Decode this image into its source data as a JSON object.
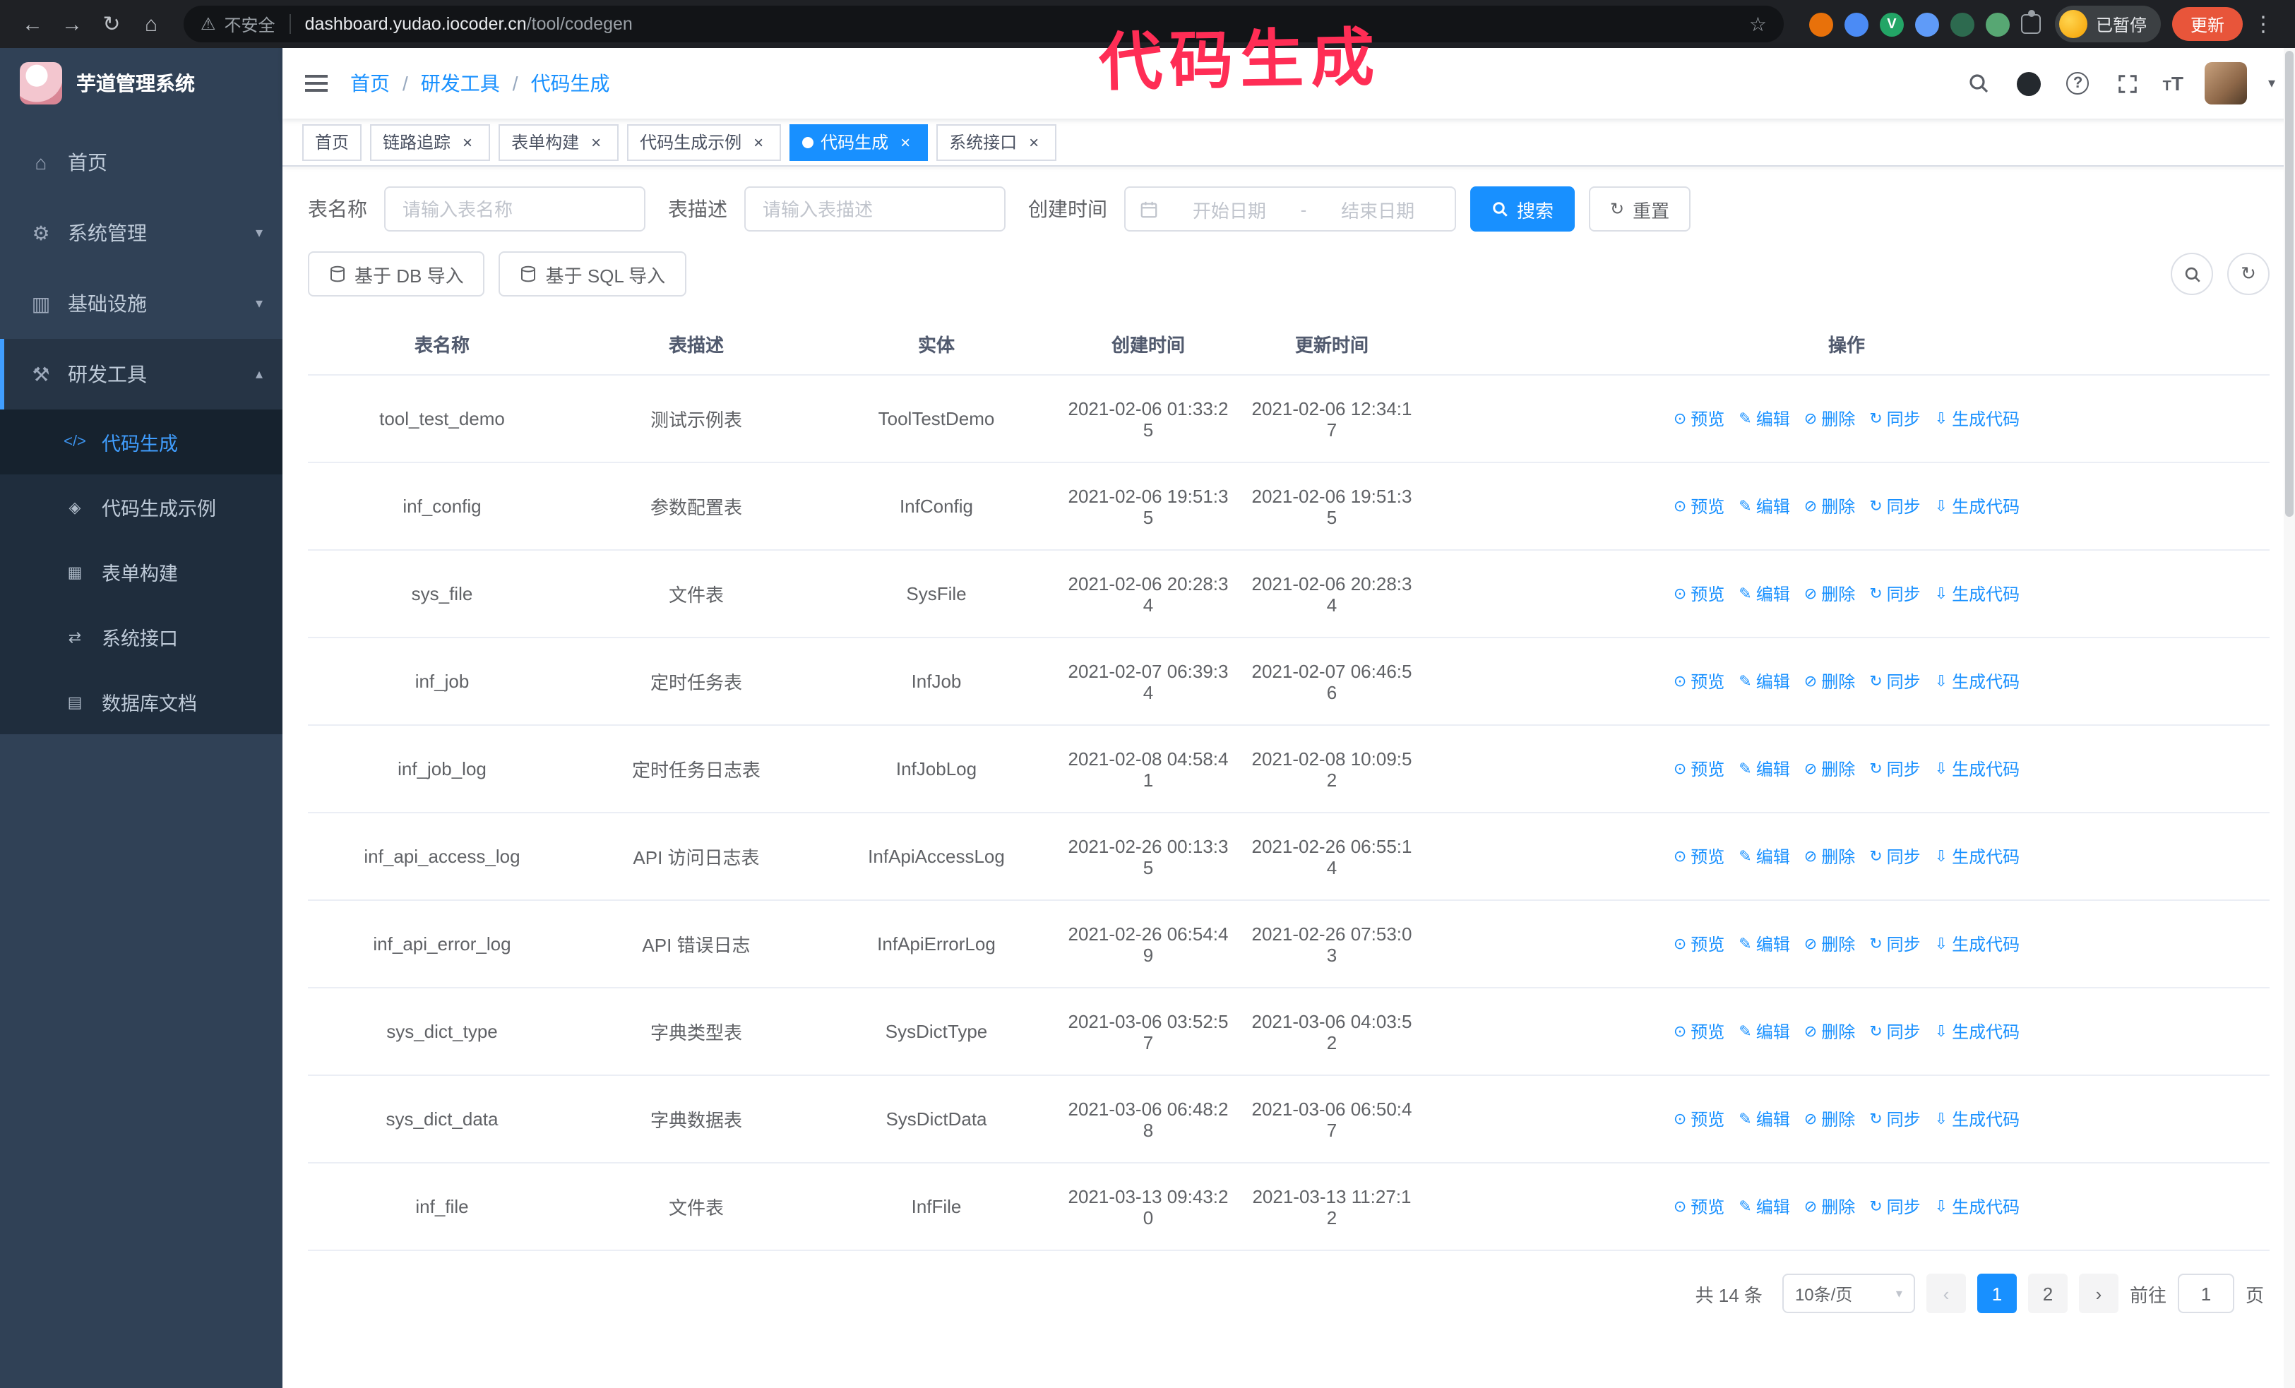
{
  "colors": {
    "accent": "#1890ff",
    "menu-active": "#409eff",
    "annotation": "#ff2d55",
    "update-btn": "#e8553a",
    "sidebar-bg": "#304156",
    "submenu-bg": "#1f2d3d"
  },
  "icons": {
    "back": "←",
    "forward": "→",
    "reload": "↻",
    "home": "⌂",
    "warning": "⚠",
    "star": "☆",
    "kebab": "⋮",
    "chevron_up": "▴",
    "chevron_down": "▾",
    "close": "×",
    "refresh": "↻",
    "prev": "‹",
    "next": "›"
  },
  "annotation": "代码生成",
  "browser": {
    "security_label": "不安全",
    "url_host": "dashboard.yudao.iocoder.cn",
    "url_path": "/tool/codegen",
    "profile_badge": "已暂停",
    "update_button": "更新"
  },
  "app_title": "芋道管理系统",
  "sidebar": {
    "items": [
      {
        "key": "home",
        "label": "首页",
        "icon": "⌂",
        "expandable": false,
        "expanded": false,
        "active": false
      },
      {
        "key": "system",
        "label": "系统管理",
        "icon": "⚙",
        "expandable": true,
        "expanded": false,
        "active": false
      },
      {
        "key": "infra",
        "label": "基础设施",
        "icon": "▥",
        "expandable": true,
        "expanded": false,
        "active": false
      },
      {
        "key": "devtools",
        "label": "研发工具",
        "icon": "⚒",
        "expandable": true,
        "expanded": true,
        "active": true
      }
    ],
    "sub_items": [
      {
        "key": "codegen",
        "label": "代码生成",
        "icon": "</>",
        "active": true
      },
      {
        "key": "codegen-example",
        "label": "代码生成示例",
        "icon": "◈",
        "active": false
      },
      {
        "key": "form-builder",
        "label": "表单构建",
        "icon": "▦",
        "active": false
      },
      {
        "key": "system-api",
        "label": "系统接口",
        "icon": "⇄",
        "active": false
      },
      {
        "key": "db-doc",
        "label": "数据库文档",
        "icon": "▤",
        "active": false
      }
    ]
  },
  "breadcrumb": [
    "首页",
    "研发工具",
    "代码生成"
  ],
  "tabs": [
    {
      "key": "home",
      "label": "首页",
      "closable": false,
      "active": false
    },
    {
      "key": "tracing",
      "label": "链路追踪",
      "closable": true,
      "active": false
    },
    {
      "key": "form-builder",
      "label": "表单构建",
      "closable": true,
      "active": false
    },
    {
      "key": "codegen-example",
      "label": "代码生成示例",
      "closable": true,
      "active": false
    },
    {
      "key": "codegen",
      "label": "代码生成",
      "closable": true,
      "active": true
    },
    {
      "key": "system-api",
      "label": "系统接口",
      "closable": true,
      "active": false
    }
  ],
  "filters": {
    "table_name_label": "表名称",
    "table_name_placeholder": "请输入表名称",
    "table_desc_label": "表描述",
    "table_desc_placeholder": "请输入表描述",
    "create_time_label": "创建时间",
    "start_date_placeholder": "开始日期",
    "date_separator": "-",
    "end_date_placeholder": "结束日期",
    "search_button": "搜索",
    "reset_button": "重置"
  },
  "toolbar": {
    "import_db_button": "基于 DB 导入",
    "import_sql_button": "基于 SQL 导入"
  },
  "table": {
    "columns": [
      "表名称",
      "表描述",
      "实体",
      "创建时间",
      "更新时间",
      "操作"
    ],
    "actions": [
      {
        "key": "preview",
        "label": "预览",
        "glyph": "⊙"
      },
      {
        "key": "edit",
        "label": "编辑",
        "glyph": "✎"
      },
      {
        "key": "delete",
        "label": "删除",
        "glyph": "⊘"
      },
      {
        "key": "sync",
        "label": "同步",
        "glyph": "↻"
      },
      {
        "key": "generate-code",
        "label": "生成代码",
        "glyph": "⇩"
      }
    ],
    "rows": [
      {
        "name": "tool_test_demo",
        "desc": "测试示例表",
        "entity": "ToolTestDemo",
        "created": "2021-02-06 01:33:25",
        "updated": "2021-02-06 12:34:17"
      },
      {
        "name": "inf_config",
        "desc": "参数配置表",
        "entity": "InfConfig",
        "created": "2021-02-06 19:51:35",
        "updated": "2021-02-06 19:51:35"
      },
      {
        "name": "sys_file",
        "desc": "文件表",
        "entity": "SysFile",
        "created": "2021-02-06 20:28:34",
        "updated": "2021-02-06 20:28:34"
      },
      {
        "name": "inf_job",
        "desc": "定时任务表",
        "entity": "InfJob",
        "created": "2021-02-07 06:39:34",
        "updated": "2021-02-07 06:46:56"
      },
      {
        "name": "inf_job_log",
        "desc": "定时任务日志表",
        "entity": "InfJobLog",
        "created": "2021-02-08 04:58:41",
        "updated": "2021-02-08 10:09:52"
      },
      {
        "name": "inf_api_access_log",
        "desc": "API 访问日志表",
        "entity": "InfApiAccessLog",
        "created": "2021-02-26 00:13:35",
        "updated": "2021-02-26 06:55:14"
      },
      {
        "name": "inf_api_error_log",
        "desc": "API 错误日志",
        "entity": "InfApiErrorLog",
        "created": "2021-02-26 06:54:49",
        "updated": "2021-02-26 07:53:03"
      },
      {
        "name": "sys_dict_type",
        "desc": "字典类型表",
        "entity": "SysDictType",
        "created": "2021-03-06 03:52:57",
        "updated": "2021-03-06 04:03:52"
      },
      {
        "name": "sys_dict_data",
        "desc": "字典数据表",
        "entity": "SysDictData",
        "created": "2021-03-06 06:48:28",
        "updated": "2021-03-06 06:50:47"
      },
      {
        "name": "inf_file",
        "desc": "文件表",
        "entity": "InfFile",
        "created": "2021-03-13 09:43:20",
        "updated": "2021-03-13 11:27:12"
      }
    ]
  },
  "pagination": {
    "total": "共 14 条",
    "page_size": "10条/页",
    "pages": [
      "1",
      "2"
    ],
    "active_page": "1",
    "goto_label": "前往",
    "goto_value": "1",
    "unit_label": "页"
  }
}
